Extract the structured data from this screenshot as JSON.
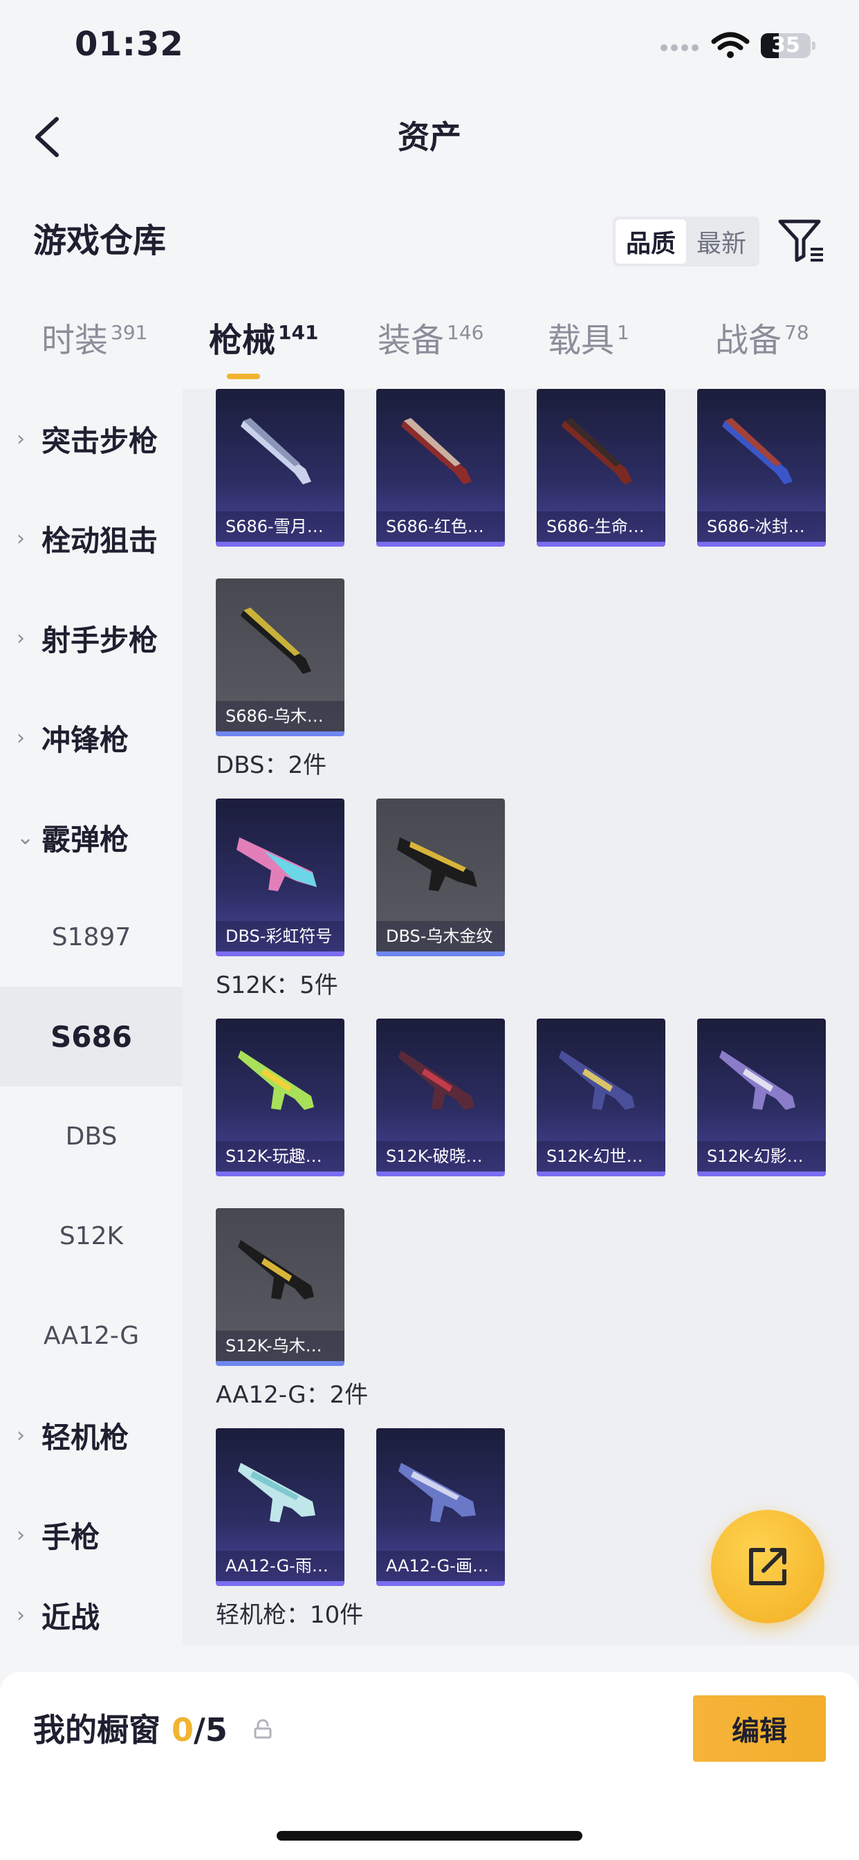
{
  "status_bar": {
    "time": "01:32",
    "battery": "35"
  },
  "nav": {
    "title": "资产"
  },
  "header": {
    "title": "游戏仓库",
    "sort_quality": "品质",
    "sort_newest": "最新"
  },
  "tabs": [
    {
      "label": "时装",
      "count": "391"
    },
    {
      "label": "枪械",
      "count": "141"
    },
    {
      "label": "装备",
      "count": "146"
    },
    {
      "label": "载具",
      "count": "1"
    },
    {
      "label": "战备",
      "count": "78"
    }
  ],
  "sidebar": {
    "categories": [
      "突击步枪",
      "栓动狙击",
      "射手步枪",
      "冲锋枪",
      "霰弹枪"
    ],
    "shotguns": [
      "S1897",
      "S686",
      "DBS",
      "S12K",
      "AA12-G"
    ],
    "more_categories": [
      "轻机枪",
      "手枪",
      "近战"
    ]
  },
  "content": {
    "s686_items": [
      "S686-雪月…",
      "S686-红色…",
      "S686-生命…",
      "S686-冰封…",
      "S686-乌木…"
    ],
    "dbs_label": "DBS：2件",
    "dbs_items": [
      "DBS-彩虹符号",
      "DBS-乌木金纹"
    ],
    "s12k_label": "S12K：5件",
    "s12k_items": [
      "S12K-玩趣…",
      "S12K-破晓…",
      "S12K-幻世…",
      "S12K-幻影…",
      "S12K-乌木…"
    ],
    "aa12_label": "AA12-G：2件",
    "aa12_items": [
      "AA12-G-雨…",
      "AA12-G-画…"
    ],
    "lmg_label": "轻机枪：10件"
  },
  "bottom": {
    "title": "我的橱窗 ",
    "count_current": "0",
    "count_total": "/5",
    "edit_label": "编辑"
  },
  "colors": {
    "accent": "#f0b431",
    "card_purple": "#2c2d62",
    "card_gray": "#5a5b63"
  }
}
